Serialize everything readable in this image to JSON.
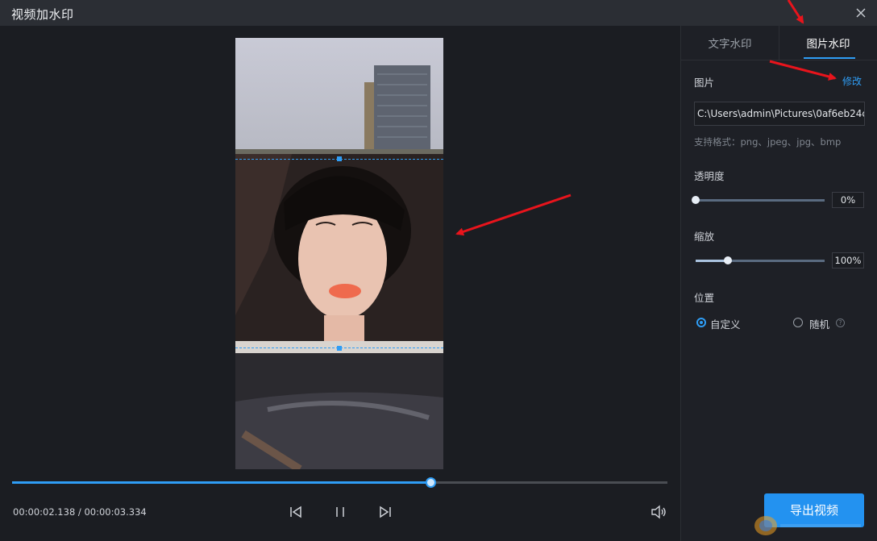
{
  "window": {
    "title": "视频加水印"
  },
  "preview": {
    "time_current": "00:00:02.138",
    "time_separator": " / ",
    "time_total": "00:00:03.334",
    "progress_fraction": 0.638
  },
  "panel": {
    "tabs": [
      {
        "label": "文字水印",
        "active": false
      },
      {
        "label": "图片水印",
        "active": true
      }
    ],
    "image_label": "图片",
    "modify_link": "修改",
    "image_path": "C:\\Users\\admin\\Pictures\\0af6eb24c",
    "format_hint": "支持格式：png、jpeg、jpg、bmp",
    "opacity_label": "透明度",
    "opacity_value": "0%",
    "opacity_fraction": 0.0,
    "scale_label": "缩放",
    "scale_value": "100%",
    "scale_fraction": 0.25,
    "position_label": "位置",
    "position_options": [
      {
        "label": "自定义",
        "selected": true
      },
      {
        "label": "随机",
        "selected": false
      }
    ]
  },
  "export_button": "导出视频",
  "colors": {
    "accent": "#2f9df5",
    "background": "#1b1d22",
    "panel": "#1e2026",
    "annotation_arrow": "#e8141c"
  },
  "icons": [
    "close-icon",
    "prev-frame-icon",
    "pause-icon",
    "next-frame-icon",
    "volume-icon",
    "help-icon"
  ]
}
